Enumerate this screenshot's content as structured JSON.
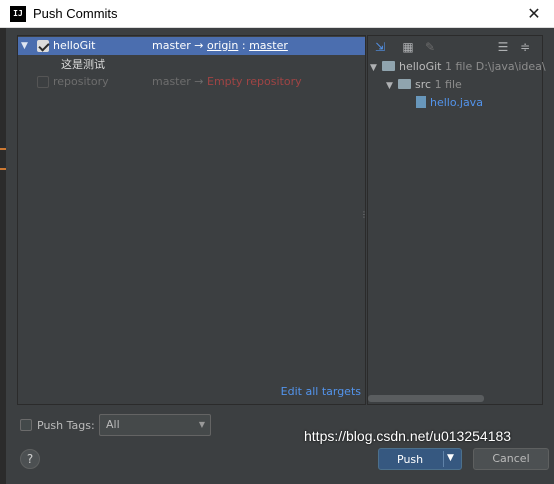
{
  "window": {
    "app_icon_text": "IJ",
    "title": "Push Commits",
    "close_glyph": "✕"
  },
  "commits_tree": {
    "rows": [
      {
        "repo": "helloGit",
        "checked": true,
        "selected": true,
        "branch": "master",
        "arrow": "→",
        "remote": "origin",
        "separator": ":",
        "target_branch": "master"
      },
      {
        "repo": "repository",
        "checked": false,
        "selected": false,
        "branch": "master",
        "arrow": "→",
        "target_note": "Empty repository"
      }
    ],
    "commit_message": "这是测试",
    "edit_all_targets": "Edit all targets"
  },
  "changes_tree": {
    "root": {
      "name": "helloGit",
      "count": "1 file",
      "path": "D:\\java\\idea\\"
    },
    "folder": {
      "name": "src",
      "count": "1 file"
    },
    "file": {
      "name": "hello.java"
    },
    "toolbar_icons": [
      "collapse-arrows-icon",
      "group-by-icon",
      "edit-source-icon",
      "expand-all-icon",
      "collapse-all-icon"
    ]
  },
  "footer": {
    "push_tags_label": "Push Tags:",
    "tags_option": "All",
    "help_glyph": "?",
    "push_label": "Push",
    "cancel_label": "Cancel"
  },
  "watermark": "https://blog.csdn.net/u013254183",
  "colors": {
    "background": "#3c3f41",
    "selection": "#4b6eaf",
    "link": "#5394ec",
    "error": "#a04444",
    "push_button": "#365880"
  }
}
